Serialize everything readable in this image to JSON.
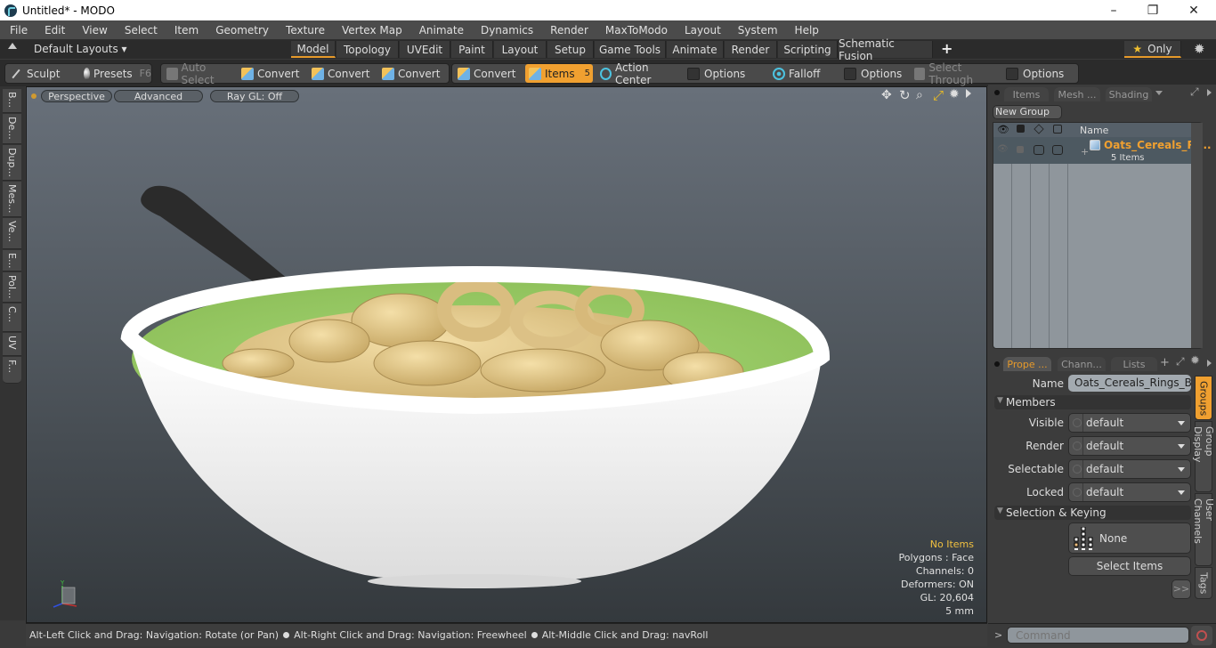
{
  "window": {
    "title": "Untitled* - MODO",
    "minimize": "–",
    "restore": "❐",
    "close": "✕"
  },
  "menu": [
    "File",
    "Edit",
    "View",
    "Select",
    "Item",
    "Geometry",
    "Texture",
    "Vertex Map",
    "Animate",
    "Dynamics",
    "Render",
    "MaxToModo",
    "Layout",
    "System",
    "Help"
  ],
  "layoutbar": {
    "layouts_label": "Default Layouts ▾",
    "tabs": [
      "Model",
      "Topology",
      "UVEdit",
      "Paint",
      "Layout",
      "Setup",
      "Game Tools",
      "Animate",
      "Render",
      "Scripting",
      "Schematic Fusion"
    ],
    "active_tab": "Model",
    "add_tab": "+",
    "only_label": "Only"
  },
  "toolbar": {
    "sculpt": "Sculpt",
    "presets": "Presets",
    "presets_key": "F6",
    "auto_select": "Auto Select",
    "convert1": "Convert",
    "convert2": "Convert",
    "convert3": "Convert",
    "convert4": "Convert",
    "items": "Items",
    "items_key": "5",
    "action_center": "Action Center",
    "options1": "Options",
    "falloff": "Falloff",
    "options2": "Options",
    "select_through": "Select Through",
    "options3": "Options"
  },
  "left_tabs": [
    "B...",
    "De...",
    "Dup...",
    "Mes...",
    "Ve...",
    "E...",
    "Pol...",
    "C...",
    "UV",
    "F..."
  ],
  "viewport": {
    "view_mode": "Perspective",
    "shading": "Advanced",
    "raygl": "Ray GL: Off",
    "stats": {
      "selection": "No Items",
      "polygons": "Polygons : Face",
      "channels": "Channels: 0",
      "deformers": "Deformers: ON",
      "gl": "GL: 20,604",
      "unit": "5 mm"
    },
    "axis": {
      "y": "Y",
      "z": "Z",
      "x": "X"
    },
    "colors": {
      "accent": "#f0a030",
      "stat_highlight": "#f0c040"
    }
  },
  "statusbar": {
    "hint1": "Alt-Left Click and Drag: Navigation: Rotate (or Pan)",
    "hint2": "Alt-Right Click and Drag: Navigation: Freewheel",
    "hint3": "Alt-Middle Click and Drag: navRoll"
  },
  "items_panel": {
    "tabs": [
      "Items",
      "Mesh ...",
      "Shading"
    ],
    "new_group": "New Group",
    "col_name": "Name",
    "rows": [
      {
        "name": "Oats_Cereals_Ri...",
        "sub": "5 Items",
        "expand": "+"
      }
    ]
  },
  "properties_panel": {
    "tabs": [
      "Prope ...",
      "Chann...",
      "Lists"
    ],
    "add": "+",
    "name_label": "Name",
    "name_value": "Oats_Cereals_Rings_Brea",
    "members_header": "Members",
    "fields": [
      {
        "label": "Visible",
        "value": "default"
      },
      {
        "label": "Render",
        "value": "default"
      },
      {
        "label": "Selectable",
        "value": "default"
      },
      {
        "label": "Locked",
        "value": "default"
      }
    ],
    "selection_header": "Selection & Keying",
    "none_label": "None",
    "select_items": "Select Items",
    "more": ">>",
    "side_tabs": [
      "Groups",
      "Group Display",
      "User Channels",
      "Tags"
    ],
    "command_prompt": ">",
    "command_placeholder": "Command"
  }
}
